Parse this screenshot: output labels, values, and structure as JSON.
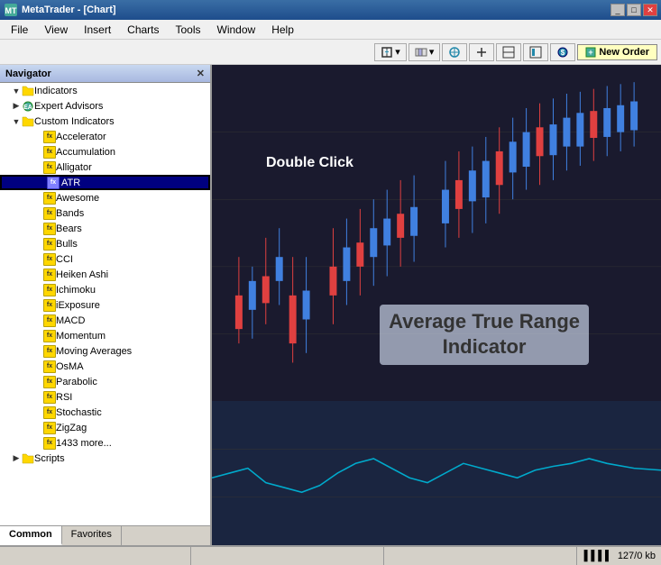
{
  "titleBar": {
    "title": "MetaTrader - [Chart]",
    "iconColor": "#316ac5"
  },
  "menuBar": {
    "items": [
      "File",
      "View",
      "Insert",
      "Charts",
      "Tools",
      "Window",
      "Help"
    ]
  },
  "toolbar": {
    "newOrderLabel": "New Order"
  },
  "navigator": {
    "title": "Navigator",
    "tree": {
      "indicators": {
        "label": "Indicators",
        "expanded": true
      },
      "expertAdvisors": {
        "label": "Expert Advisors"
      },
      "customIndicators": {
        "label": "Custom Indicators",
        "expanded": true
      },
      "items": [
        "Accelerator",
        "Accumulation",
        "Alligator",
        "ATR",
        "Awesome",
        "Bands",
        "Bears",
        "Bulls",
        "CCI",
        "Heiken Ashi",
        "Ichimoku",
        "iExposure",
        "MACD",
        "Momentum",
        "Moving Averages",
        "OsMA",
        "Parabolic",
        "RSI",
        "Stochastic",
        "ZigZag",
        "1433 more..."
      ],
      "scripts": {
        "label": "Scripts"
      }
    },
    "tabs": [
      "Common",
      "Favorites"
    ]
  },
  "chart": {
    "doubleClickLabel": "Double Click",
    "atrLabel": "Average True Range\nIndicator"
  },
  "statusBar": {
    "memInfo": "127/0 kb"
  }
}
